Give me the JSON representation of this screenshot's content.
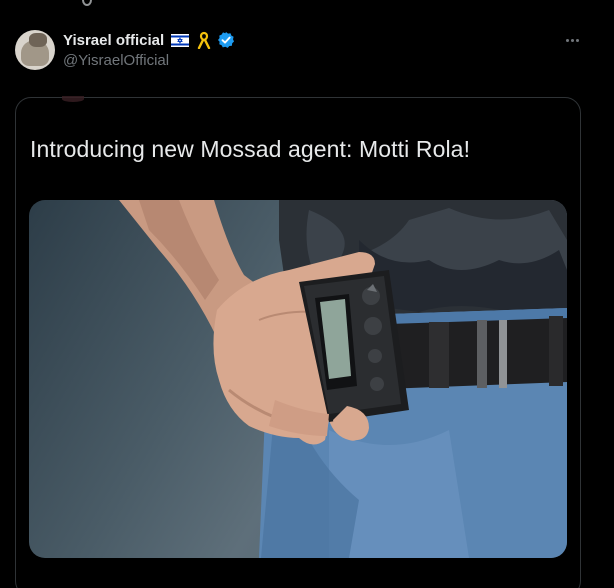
{
  "author": {
    "display_name": "Yisrael official",
    "handle": "@YisraelOfficial",
    "badges": [
      "israel-flag-icon",
      "yellow-ribbon-icon",
      "verified-badge-icon"
    ]
  },
  "more_menu": {
    "icon": "more-horizontal-icon"
  },
  "quoted_post": {
    "text": "Introducing new Mossad agent: Motti Rola!",
    "image_description_icon": "photo-of-pager-on-belt"
  },
  "colors": {
    "background": "#000000",
    "text_primary": "#e7e9ea",
    "text_secondary": "#71767b",
    "border": "#2f3336",
    "verified": "#1d9bf0",
    "flag_blue": "#0038b8",
    "ribbon": "#f4c20d"
  }
}
